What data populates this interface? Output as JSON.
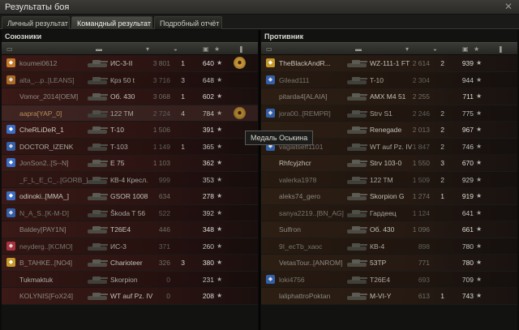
{
  "window": {
    "title": "Результаты боя",
    "close_icon": "close-icon"
  },
  "tabs": [
    {
      "label": "Личный результат",
      "active": false
    },
    {
      "label": "Командный результат",
      "active": true
    },
    {
      "label": "Подробный отчёт",
      "active": false
    }
  ],
  "allies": {
    "title": "Союзники",
    "columns": [
      "squad-icon",
      "tank-icon",
      "level-icon",
      "vehicle-icon",
      "damage-icon",
      "frags-icon",
      "star-icon",
      "medal-icon"
    ],
    "rows": [
      {
        "player": "koumei0612",
        "vehicle": "ИС-3-II",
        "damage": "3 801",
        "frags": "1",
        "xp": "640",
        "badge": "#c47a2a",
        "medal": true,
        "state": "dead"
      },
      {
        "player": "alta_...p..[LEANS]",
        "vehicle": "Крз 50 t",
        "damage": "3 716",
        "frags": "3",
        "xp": "648",
        "badge": "#c47a2a",
        "medal": false,
        "state": "dead"
      },
      {
        "player": "Vomor_2014[OEM]",
        "vehicle": "Об. 430",
        "damage": "3 068",
        "frags": "1",
        "xp": "602",
        "badge": "",
        "medal": false,
        "state": "dead"
      },
      {
        "player": "aapra[YAP_0]",
        "vehicle": "122 TM",
        "damage": "2 724",
        "frags": "4",
        "xp": "784",
        "badge": "",
        "medal": true,
        "state": "self"
      },
      {
        "player": "CheRLiDeR_1",
        "vehicle": "T-10",
        "damage": "1 506",
        "frags": "",
        "xp": "391",
        "badge": "#3a6ec4",
        "medal": false,
        "state": "alive"
      },
      {
        "player": "DOCTOR_IZENK",
        "vehicle": "T-103",
        "damage": "1 149",
        "frags": "1",
        "xp": "365",
        "badge": "#3a6ec4",
        "medal": false,
        "state": "alive"
      },
      {
        "player": "JonSon2..[S--N]",
        "vehicle": "E 75",
        "damage": "1 103",
        "frags": "",
        "xp": "362",
        "badge": "#3a6ec4",
        "medal": false,
        "state": "dead"
      },
      {
        "player": "_F_L_E_C_..[GORB_]",
        "vehicle": "КВ-4 Кресл.",
        "damage": "999",
        "frags": "",
        "xp": "353",
        "badge": "",
        "medal": false,
        "state": "dead"
      },
      {
        "player": "odinoki..[MMA_]",
        "vehicle": "GSOR 1008",
        "damage": "634",
        "frags": "",
        "xp": "278",
        "badge": "#3a6ec4",
        "medal": false,
        "state": "alive"
      },
      {
        "player": "N_A_S..[K-M-D]",
        "vehicle": "Škoda T 56",
        "damage": "522",
        "frags": "",
        "xp": "392",
        "badge": "#3a6ec4",
        "medal": false,
        "state": "dead"
      },
      {
        "player": "Baldey[PAY1N]",
        "vehicle": "T26E4",
        "damage": "446",
        "frags": "",
        "xp": "348",
        "badge": "",
        "medal": false,
        "state": "dead"
      },
      {
        "player": "neyderg..[KCMO]",
        "vehicle": "ИС-3",
        "damage": "371",
        "frags": "",
        "xp": "260",
        "badge": "#c43a4a",
        "medal": false,
        "state": "dead"
      },
      {
        "player": "B_TAHKE..[NO4]",
        "vehicle": "Charioteer",
        "damage": "326",
        "frags": "3",
        "xp": "380",
        "badge": "#c49a2a",
        "medal": false,
        "state": "dead"
      },
      {
        "player": "Tukmaktuk",
        "vehicle": "Skorpion",
        "damage": "0",
        "frags": "",
        "xp": "231",
        "badge": "",
        "medal": false,
        "state": "alive"
      },
      {
        "player": "KOLYNIS[FoX24]",
        "vehicle": "WT auf Pz. IV",
        "damage": "0",
        "frags": "",
        "xp": "208",
        "badge": "",
        "medal": false,
        "state": "dead"
      }
    ]
  },
  "enemies": {
    "title": "Противник",
    "rows": [
      {
        "player": "TheBlackAndR...",
        "vehicle": "WZ-111-1 FT",
        "damage": "2 614",
        "frags": "2",
        "xp": "939",
        "badge": "#c49a2a",
        "state": "alive"
      },
      {
        "player": "Gilead111",
        "vehicle": "T-10",
        "damage": "2 304",
        "frags": "",
        "xp": "944",
        "badge": "#3a6ec4",
        "state": "dead"
      },
      {
        "player": "pitardа4[ALAIA]",
        "vehicle": "AMX M4 51",
        "damage": "2 255",
        "frags": "",
        "xp": "711",
        "badge": "",
        "state": "dead"
      },
      {
        "player": "jora00..[REMPR]",
        "vehicle": "Strv S1",
        "damage": "2 246",
        "frags": "2",
        "xp": "775",
        "badge": "#3a6ec4",
        "state": "dead"
      },
      {
        "player": "",
        "vehicle": "Renegade",
        "damage": "2 013",
        "frags": "2",
        "xp": "967",
        "badge": "",
        "state": "dead"
      },
      {
        "player": "vagaitseff1101",
        "vehicle": "WT auf Pz. IV",
        "damage": "1 847",
        "frags": "2",
        "xp": "746",
        "badge": "#3a6ec4",
        "state": "dead"
      },
      {
        "player": "Rhfcyjzhcr",
        "vehicle": "Strv 103-0",
        "damage": "1 550",
        "frags": "3",
        "xp": "670",
        "badge": "",
        "state": "alive"
      },
      {
        "player": "valerka1978",
        "vehicle": "122 TM",
        "damage": "1 509",
        "frags": "2",
        "xp": "929",
        "badge": "",
        "state": "dead"
      },
      {
        "player": "aleks74_gero",
        "vehicle": "Skorpion G",
        "damage": "1 274",
        "frags": "1",
        "xp": "919",
        "badge": "",
        "state": "dead"
      },
      {
        "player": "sanya2219..[BN_AG]",
        "vehicle": "Гардеец",
        "damage": "1 124",
        "frags": "",
        "xp": "641",
        "badge": "",
        "state": "dead"
      },
      {
        "player": "Sulfron",
        "vehicle": "Об. 430",
        "damage": "1 096",
        "frags": "",
        "xp": "661",
        "badge": "",
        "state": "dead"
      },
      {
        "player": "9I_ecTb_xaoc",
        "vehicle": "КВ-4",
        "damage": "898",
        "frags": "",
        "xp": "780",
        "badge": "",
        "state": "dead"
      },
      {
        "player": "VetasTour..[ANROM]",
        "vehicle": "53TP",
        "damage": "771",
        "frags": "",
        "xp": "780",
        "badge": "",
        "state": "dead"
      },
      {
        "player": "loki4756",
        "vehicle": "T26E4",
        "damage": "693",
        "frags": "",
        "xp": "709",
        "badge": "#3a6ec4",
        "state": "dead"
      },
      {
        "player": "laliphattroPoktan",
        "vehicle": "M-VI-Y",
        "damage": "613",
        "frags": "1",
        "xp": "743",
        "badge": "",
        "state": "dead"
      }
    ]
  },
  "tooltip": {
    "text": "Медаль Оськина"
  }
}
